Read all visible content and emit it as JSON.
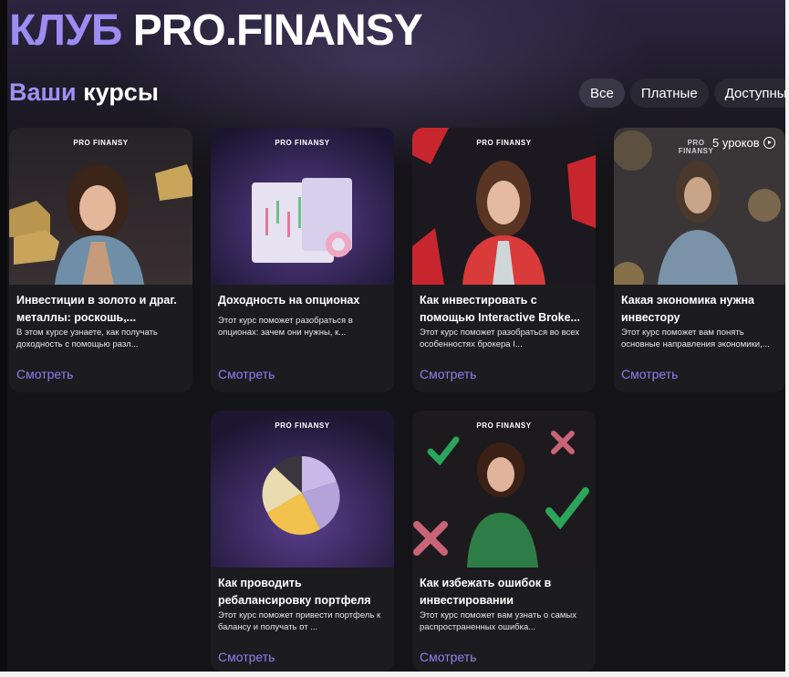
{
  "header": {
    "title_part1": "КЛУБ",
    "title_part2": "PRO.FINANSY"
  },
  "section": {
    "title_part1": "Ваши",
    "title_part2": "курсы"
  },
  "filters": [
    {
      "label": "Все",
      "active": true
    },
    {
      "label": "Платные",
      "active": false
    },
    {
      "label": "Доступные",
      "active": false
    }
  ],
  "brand_label": "PRO FINANSY",
  "courses": [
    {
      "title": "Инвестиции в золото и драг. металлы: роскошь,...",
      "description": "В этом курсе узнаете, как получать доходность с помощью разл...",
      "link": "Смотреть"
    },
    {
      "title": "Доходность на опционах",
      "description": "Этот курс поможет разобраться в опционах: зачем они нужны, к...",
      "link": "Смотреть"
    },
    {
      "title": "Как инвестировать с помощью Interactive Broke...",
      "description": "Этот курс поможет разобраться во всех особенностях брокера I...",
      "link": "Смотреть"
    },
    {
      "title": "Какая экономика нужна инвестору",
      "description": "Этот курс поможет вам понять основные направления экономики,...",
      "link": "Смотреть",
      "lessons": "5 уроков"
    },
    {
      "title": "Как проводить ребалансировку портфеля",
      "description": "Этот курс поможет привести портфель к балансу и получать от ...",
      "link": "Смотреть"
    },
    {
      "title": "Как избежать ошибок в инвестировании",
      "description": "Этот курс поможет вам узнать о самых распространенных ошибка...",
      "link": "Смотреть"
    }
  ],
  "colors": {
    "accent": "#9d8cf2",
    "background": "#141317",
    "card": "#1c1b20"
  }
}
